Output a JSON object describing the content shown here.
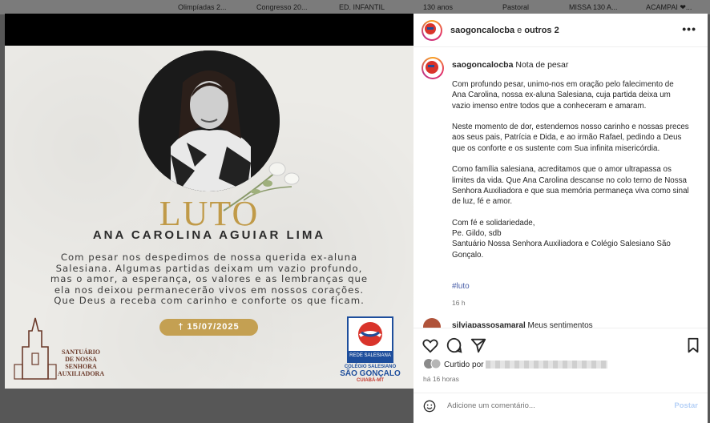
{
  "bookmarks": [
    "Olimpíadas 2...",
    "Congresso 20...",
    "ED. INFANTIL",
    "130 anos",
    "Pastoral",
    "MISSA 130 A...",
    "ACAMPAI ❤..."
  ],
  "post_image": {
    "title": "LUTO",
    "name": "ANA CAROLINA AGUIAR LIMA",
    "message_lines": [
      "Com pesar nos despedimos de nossa querida ex-aluna",
      "Salesiana. Algumas partidas deixam um vazio profundo,",
      "mas o amor, a esperança, os valores e as lembranças que",
      "ela nos deixou permanecerão vivos em nossos corações.",
      "Que Deus a receba com carinho e conforte os que ficam."
    ],
    "date": "† 15/07/2025",
    "santuario_lines": [
      "SANTUÁRIO",
      "DE NOSSA",
      "SENHORA",
      "AUXILIADORA"
    ],
    "colegio_band": "REDE SALESIANA",
    "colegio_lines": [
      "COLÉGIO SALESIANO",
      "SÃO GONÇALO",
      "CUIABÁ-MT"
    ]
  },
  "header": {
    "username": "saogoncalocba",
    "connector": " e ",
    "others": "outros 2",
    "more": "•••"
  },
  "caption": {
    "username": "saogoncalocba",
    "title": " Nota de pesar",
    "paragraphs": [
      "Com profundo pesar, unimo-nos em oração pelo falecimento de Ana Carolina, nossa ex-aluna Salesiana, cuja partida deixa um vazio imenso entre todos que a conheceram e amaram.",
      "Neste momento de dor, estendemos nosso carinho e nossas preces aos seus pais, Patrícia e Dida, e ao irmão Rafael, pedindo a Deus que os conforte e os sustente com Sua infinita misericórdia.",
      "Como família salesiana, acreditamos que o amor ultrapassa os limites da vida. Que Ana Carolina descanse no colo terno de Nossa Senhora Auxiliadora e que sua memória permaneça viva como sinal de luz, fé e amor.",
      "Com fé e solidariedade,\nPe. Gildo, sdb\nSantuário Nossa Senhora Auxiliadora e Colégio Salesiano São Gonçalo."
    ],
    "hashtag": "#luto",
    "time": "16 h"
  },
  "comment_peek": {
    "username": "silviapassosamaral",
    "text": " Meus sentimentos"
  },
  "actions": {
    "liked_by_label": "Curtido por",
    "time_ago": "há 16 horas",
    "comment_placeholder": "Adicione um comentário...",
    "post_label": "Postar"
  }
}
